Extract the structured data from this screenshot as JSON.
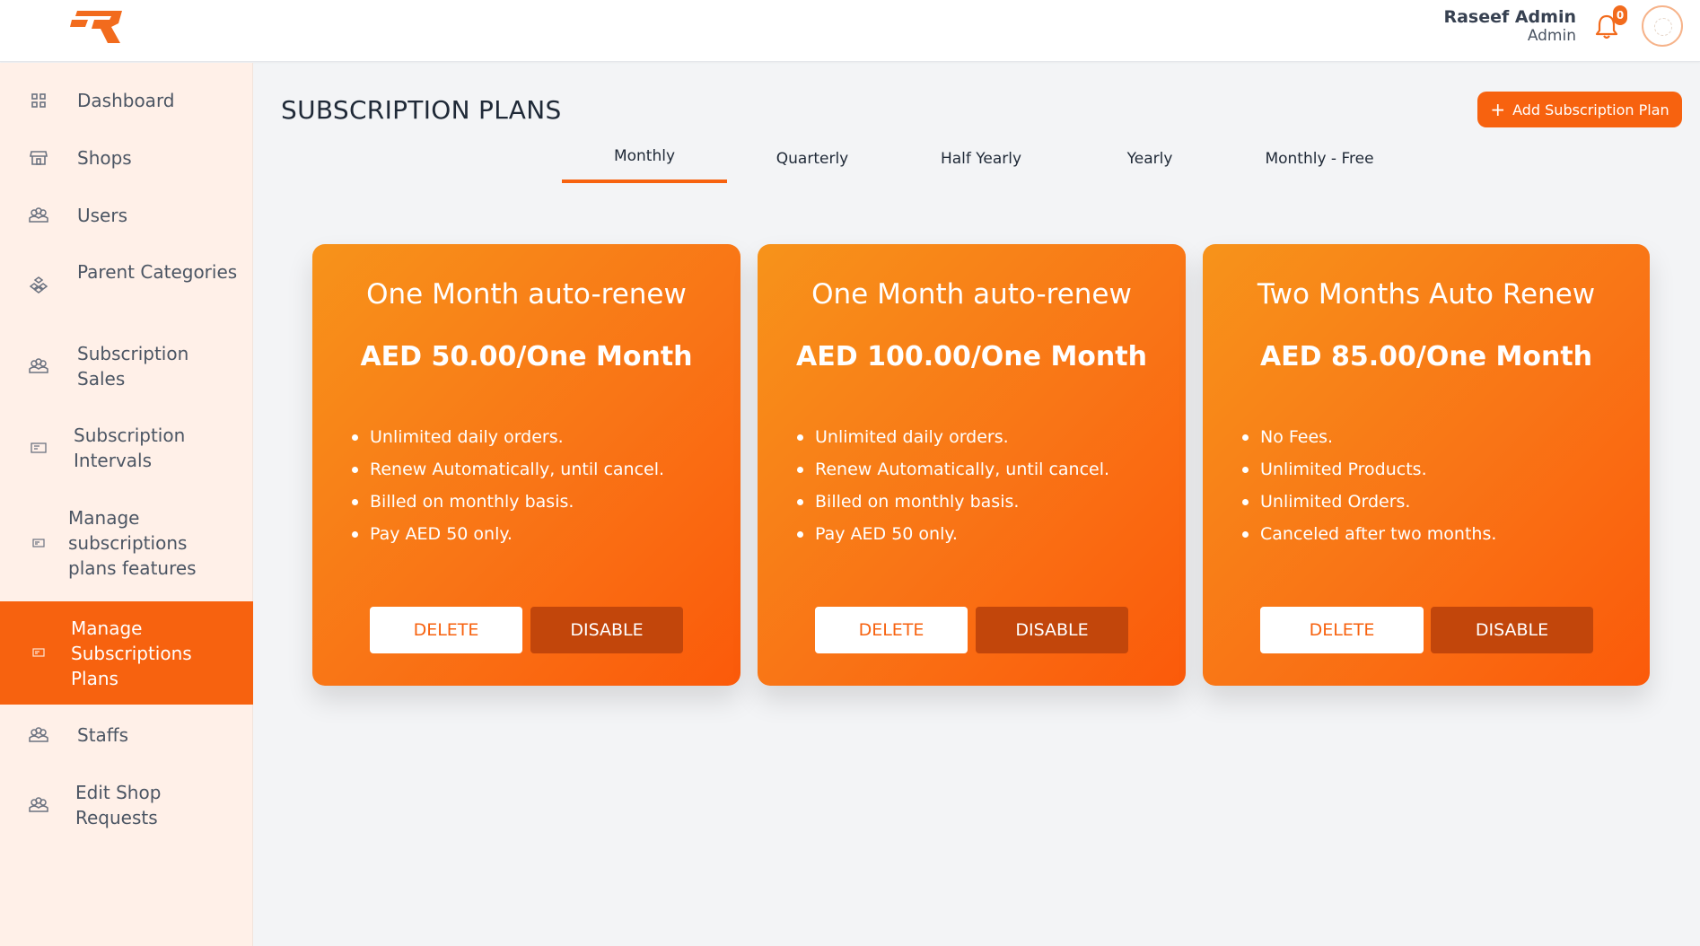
{
  "header": {
    "user_name": "Raseef Admin",
    "user_role": "Admin",
    "notification_count": "0",
    "brand_color": "#f7620f"
  },
  "sidebar": {
    "items": [
      {
        "label": "Dashboard",
        "icon": "dashboard-grid-icon"
      },
      {
        "label": "Shops",
        "icon": "store-icon"
      },
      {
        "label": "Users",
        "icon": "users-icon"
      },
      {
        "label": "Parent Categories",
        "icon": "categories-icon"
      },
      {
        "label": "Subscription Sales",
        "icon": "people-icon"
      },
      {
        "label": "Subscription Intervals",
        "icon": "ticket-icon"
      },
      {
        "label": "Manage subscriptions plans features",
        "icon": "ticket-icon"
      },
      {
        "label": "Manage Subscriptions Plans",
        "icon": "ticket-icon",
        "active": true
      },
      {
        "label": "Staffs",
        "icon": "people-icon"
      },
      {
        "label": "Edit Shop Requests",
        "icon": "people-icon"
      }
    ]
  },
  "main": {
    "title": "SUBSCRIPTION PLANS",
    "add_button_label": "Add Subscription Plan",
    "tabs": [
      "Monthly",
      "Quarterly",
      "Half Yearly",
      "Yearly",
      "Monthly - Free"
    ],
    "active_tab": "Monthly",
    "plans": [
      {
        "title": "One Month auto-renew",
        "price": "AED 50.00/One Month",
        "features": [
          "Unlimited daily orders.",
          "Renew Automatically, until cancel.",
          "Billed on monthly basis.",
          "Pay AED 50 only."
        ],
        "delete_label": "DELETE",
        "disable_label": "DISABLE"
      },
      {
        "title": "One Month auto-renew",
        "price": "AED 100.00/One Month",
        "features": [
          "Unlimited daily orders.",
          "Renew Automatically, until cancel.",
          "Billed on monthly basis.",
          "Pay AED 50 only."
        ],
        "delete_label": "DELETE",
        "disable_label": "DISABLE"
      },
      {
        "title": "Two Months Auto Renew",
        "price": "AED 85.00/One Month",
        "features": [
          "No Fees.",
          "Unlimited Products.",
          "Unlimited Orders.",
          "Canceled after two months."
        ],
        "delete_label": "DELETE",
        "disable_label": "DISABLE"
      }
    ]
  }
}
